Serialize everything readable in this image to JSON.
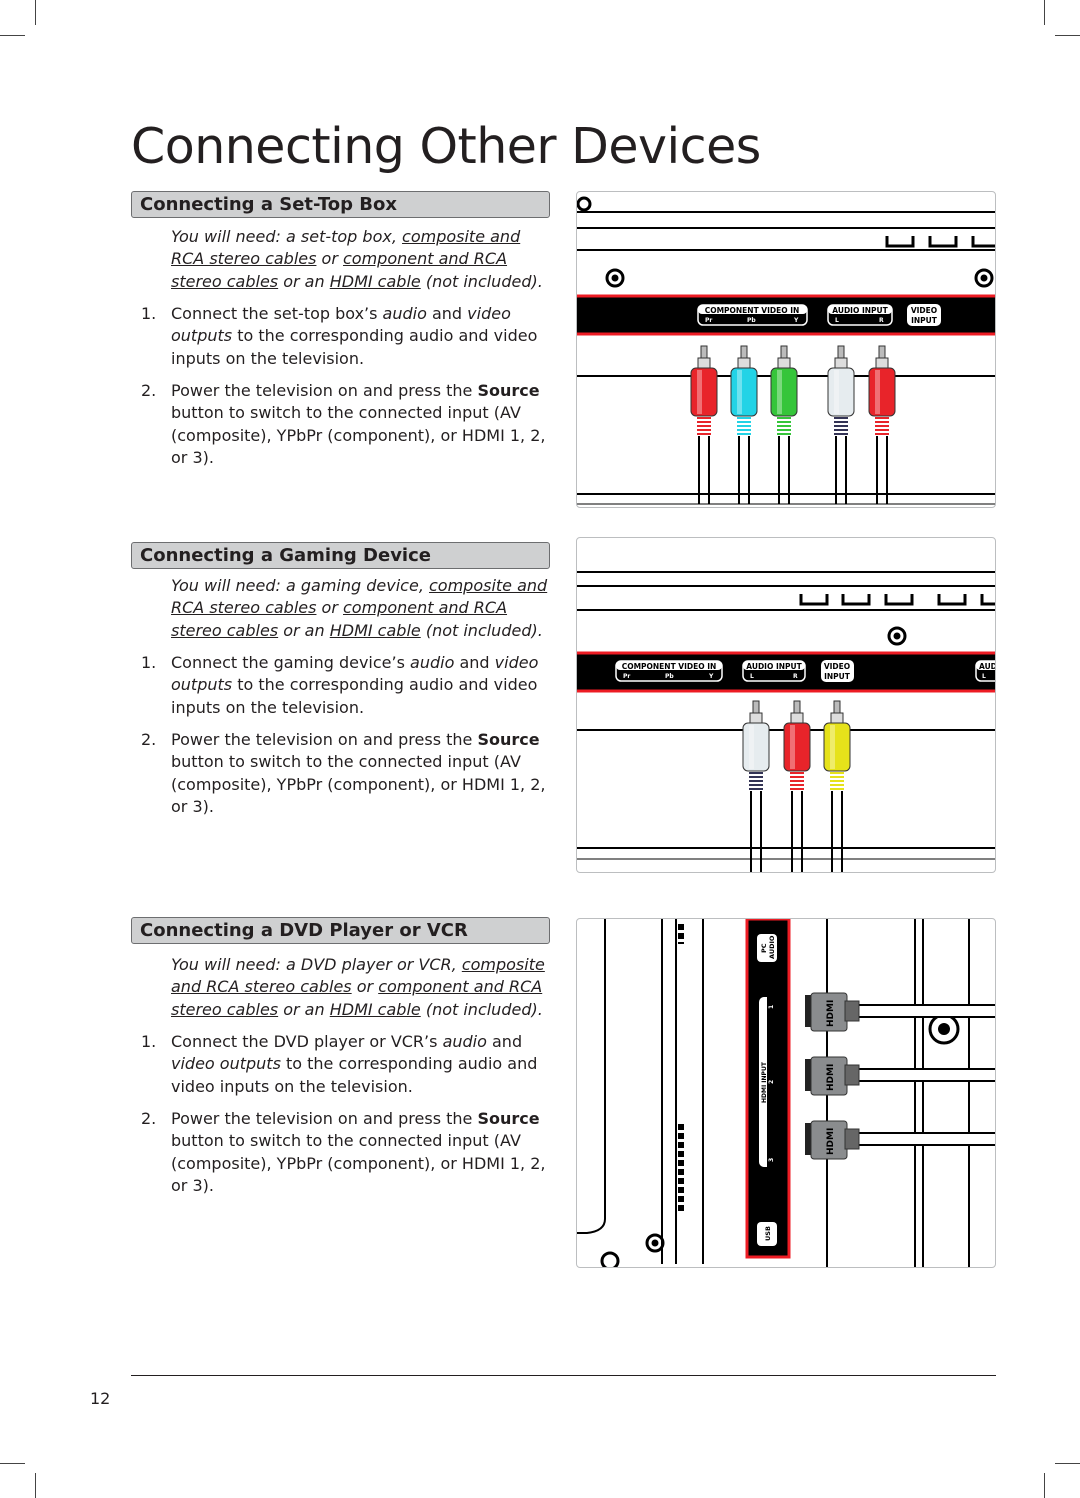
{
  "title": "Connecting Other Devices",
  "page_number": "12",
  "sections": [
    {
      "heading": "Connecting a Set-Top Box",
      "need": [
        {
          "t": "You will need: a set-top box, ",
          "i": true
        },
        {
          "t": "composite and RCA stereo cables",
          "i": true,
          "u": true
        },
        {
          "t": " or ",
          "i": true
        },
        {
          "t": "component and RCA stereo cables",
          "i": true,
          "u": true
        },
        {
          "t": " or an ",
          "i": true
        },
        {
          "t": "HDMI cable",
          "i": true,
          "u": true
        },
        {
          "t": " (not included).",
          "i": true
        }
      ],
      "steps": [
        {
          "num": "1.",
          "segs": [
            {
              "t": "Connect the set-top box’s "
            },
            {
              "t": "audio",
              "i": true
            },
            {
              "t": " and "
            },
            {
              "t": "video outputs",
              "i": true
            },
            {
              "t": " to the corresponding audio and video inputs on the television."
            }
          ]
        },
        {
          "num": "2.",
          "segs": [
            {
              "t": "Power the television on and press the "
            },
            {
              "t": "Source",
              "b": true
            },
            {
              "t": " button to switch to the connected input (AV (composite), YPbPr (component), or HDMI 1, 2, or 3)."
            }
          ]
        }
      ]
    },
    {
      "heading": "Connecting a Gaming Device",
      "need": [
        {
          "t": "You will need: a gaming device, ",
          "i": true
        },
        {
          "t": "composite and RCA stereo cables",
          "i": true,
          "u": true
        },
        {
          "t": " or ",
          "i": true
        },
        {
          "t": "component and RCA stereo cables",
          "i": true,
          "u": true
        },
        {
          "t": " or an ",
          "i": true
        },
        {
          "t": "HDMI cable",
          "i": true,
          "u": true
        },
        {
          "t": " (not included).",
          "i": true
        }
      ],
      "steps": [
        {
          "num": "1.",
          "segs": [
            {
              "t": "Connect the gaming device’s "
            },
            {
              "t": "audio",
              "i": true
            },
            {
              "t": " and "
            },
            {
              "t": "video outputs",
              "i": true
            },
            {
              "t": " to the corresponding audio and video inputs on the television."
            }
          ]
        },
        {
          "num": "2.",
          "segs": [
            {
              "t": "Power the television on and press the "
            },
            {
              "t": "Source",
              "b": true
            },
            {
              "t": " button to switch to the connected input (AV (composite), YPbPr (component), or HDMI 1, 2, or 3)."
            }
          ]
        }
      ]
    },
    {
      "heading": "Connecting a DVD Player or VCR",
      "need": [
        {
          "t": "You will need: a DVD player or VCR, ",
          "i": true
        },
        {
          "t": "composite and RCA stereo cables",
          "i": true,
          "u": true
        },
        {
          "t": " or ",
          "i": true
        },
        {
          "t": "component and RCA stereo cables",
          "i": true,
          "u": true
        },
        {
          "t": " or an ",
          "i": true
        },
        {
          "t": "HDMI cable",
          "i": true,
          "u": true
        },
        {
          "t": " (not included).",
          "i": true
        }
      ],
      "steps": [
        {
          "num": "1.",
          "segs": [
            {
              "t": "Connect the DVD player or VCR’s "
            },
            {
              "t": "audio",
              "i": true
            },
            {
              "t": " and "
            },
            {
              "t": "video outputs",
              "i": true
            },
            {
              "t": " to the corresponding audio and video inputs on the television."
            }
          ]
        },
        {
          "num": "2.",
          "segs": [
            {
              "t": "Power the television on and press the "
            },
            {
              "t": "Source",
              "b": true
            },
            {
              "t": " button to switch to the connected input (AV (composite), YPbPr (component), or HDMI 1, 2, or 3)."
            }
          ]
        }
      ]
    }
  ],
  "diagram_labels": {
    "component": "COMPONENT VIDEO IN",
    "pr": "Pr",
    "pb": "Pb",
    "y": "Y",
    "audio": "AUDIO INPUT",
    "l": "L",
    "r": "R",
    "video1": "VIDEO",
    "video2": "INPUT",
    "audio_cut": "AUDI",
    "pc1": "PC",
    "pc2": "AUDIO",
    "hdmi_input": "HDMI INPUT",
    "h1": "1",
    "h2": "2",
    "h3": "3",
    "usb": "USB",
    "hdmi_plug": "HDMI"
  },
  "plug_colors": {
    "set_top": [
      "#e8242a",
      "#22d3e6",
      "#35c53a",
      "#e6ecef",
      "#e8242a"
    ],
    "gaming": [
      "#e6ecef",
      "#e8242a",
      "#e6e21a"
    ]
  },
  "accent_red": "#ed1c24"
}
